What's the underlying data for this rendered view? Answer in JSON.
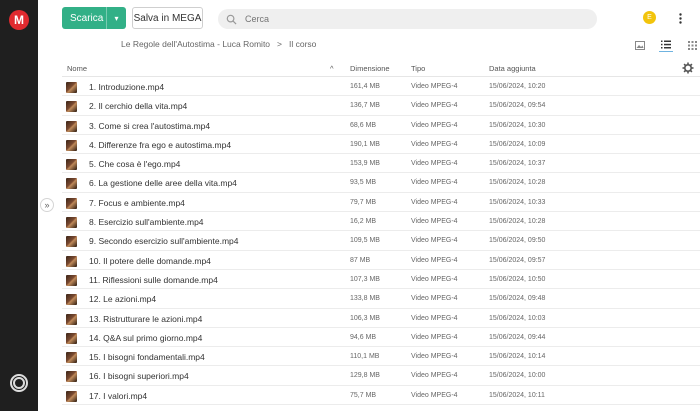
{
  "topbar": {
    "download_label": "Scarica",
    "save_label": "Salva in MEGA",
    "search_placeholder": "Cerca",
    "avatar_initial": "E"
  },
  "logo": {
    "letter": "M"
  },
  "breadcrumb": {
    "folder": "Le Regole dell'Autostima - Luca Romito",
    "separator": ">",
    "current": "Il corso"
  },
  "table": {
    "headers": {
      "name": "Nome",
      "size": "Dimensione",
      "type": "Tipo",
      "date": "Data aggiunta"
    },
    "rows": [
      {
        "name": "1. Introduzione.mp4",
        "size": "161,4 MB",
        "type": "Video MPEG-4",
        "date": "15/06/2024, 10:20"
      },
      {
        "name": "2. Il cerchio della vita.mp4",
        "size": "136,7 MB",
        "type": "Video MPEG-4",
        "date": "15/06/2024, 09:54"
      },
      {
        "name": "3. Come si crea l'autostima.mp4",
        "size": "68,6 MB",
        "type": "Video MPEG-4",
        "date": "15/06/2024, 10:30"
      },
      {
        "name": "4. Differenze fra ego e autostima.mp4",
        "size": "190,1 MB",
        "type": "Video MPEG-4",
        "date": "15/06/2024, 10:09"
      },
      {
        "name": "5. Che cosa è l'ego.mp4",
        "size": "153,9 MB",
        "type": "Video MPEG-4",
        "date": "15/06/2024, 10:37"
      },
      {
        "name": "6. La gestione delle aree della vita.mp4",
        "size": "93,5 MB",
        "type": "Video MPEG-4",
        "date": "15/06/2024, 10:28"
      },
      {
        "name": "7. Focus e ambiente.mp4",
        "size": "79,7 MB",
        "type": "Video MPEG-4",
        "date": "15/06/2024, 10:33"
      },
      {
        "name": "8. Esercizio sull'ambiente.mp4",
        "size": "16,2 MB",
        "type": "Video MPEG-4",
        "date": "15/06/2024, 10:28"
      },
      {
        "name": "9. Secondo esercizio sull'ambiente.mp4",
        "size": "109,5 MB",
        "type": "Video MPEG-4",
        "date": "15/06/2024, 09:50"
      },
      {
        "name": "10. Il potere delle domande.mp4",
        "size": "87 MB",
        "type": "Video MPEG-4",
        "date": "15/06/2024, 09:57"
      },
      {
        "name": "11. Riflessioni sulle domande.mp4",
        "size": "107,3 MB",
        "type": "Video MPEG-4",
        "date": "15/06/2024, 10:50"
      },
      {
        "name": "12. Le azioni.mp4",
        "size": "133,8 MB",
        "type": "Video MPEG-4",
        "date": "15/06/2024, 09:48"
      },
      {
        "name": "13. Ristrutturare le azioni.mp4",
        "size": "106,3 MB",
        "type": "Video MPEG-4",
        "date": "15/06/2024, 10:03"
      },
      {
        "name": "14. Q&A sul primo giorno.mp4",
        "size": "94,6 MB",
        "type": "Video MPEG-4",
        "date": "15/06/2024, 09:44"
      },
      {
        "name": "15. I bisogni fondamentali.mp4",
        "size": "110,1 MB",
        "type": "Video MPEG-4",
        "date": "15/06/2024, 10:14"
      },
      {
        "name": "16. I bisogni superiori.mp4",
        "size": "129,8 MB",
        "type": "Video MPEG-4",
        "date": "15/06/2024, 10:00"
      },
      {
        "name": "17. I valori.mp4",
        "size": "75,7 MB",
        "type": "Video MPEG-4",
        "date": "15/06/2024, 10:11"
      }
    ]
  },
  "colors": {
    "accent": "#32b087",
    "logo": "#e02a2f",
    "avatar": "#f2c40c",
    "sidebar": "#1f1f1f"
  }
}
